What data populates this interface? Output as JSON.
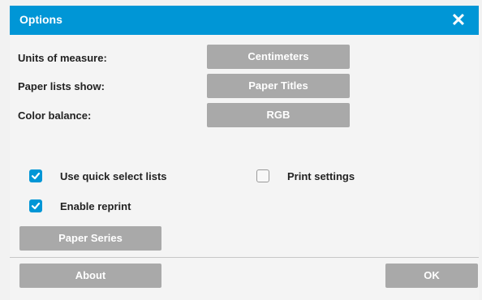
{
  "window": {
    "title": "Options",
    "close_symbol": "✕"
  },
  "settings": [
    {
      "label": "Units of measure:",
      "value": "Centimeters"
    },
    {
      "label": "Paper lists show:",
      "value": "Paper Titles"
    },
    {
      "label": "Color balance:",
      "value": "RGB"
    }
  ],
  "checkboxes": {
    "quick_select": {
      "label": "Use quick select lists",
      "checked": true
    },
    "enable_reprint": {
      "label": "Enable reprint",
      "checked": true
    },
    "print_settings": {
      "label": "Print settings",
      "checked": false
    }
  },
  "buttons": {
    "paper_series": "Paper Series",
    "about": "About",
    "ok": "OK"
  },
  "colors": {
    "accent": "#0096d6",
    "button_gray": "#a9a9a9"
  }
}
